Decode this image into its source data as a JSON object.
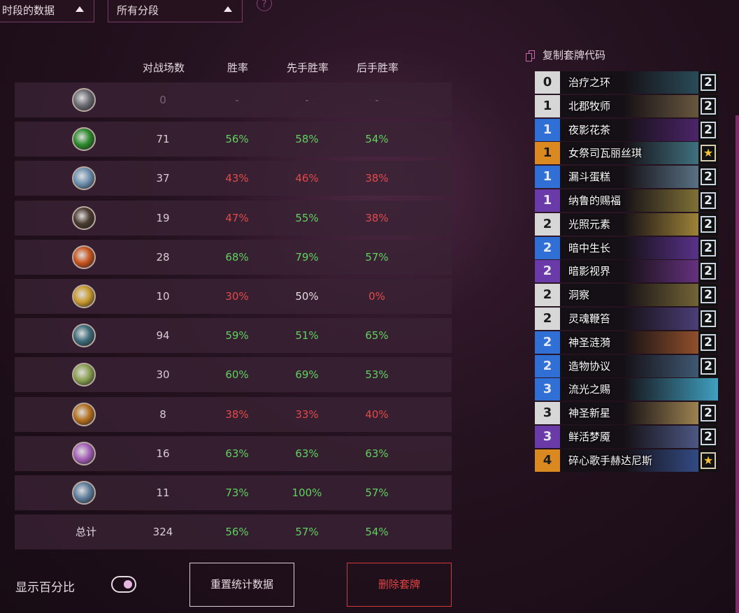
{
  "filters": {
    "rank_data": "时段的数据",
    "rank_segment": "所有分段",
    "help": "?"
  },
  "table": {
    "headers": {
      "games": "对战场数",
      "winrate": "胜率",
      "first": "先手胜率",
      "second": "后手胜率"
    },
    "rows": [
      {
        "hero_icon": "neutral-class-icon",
        "games": "0",
        "winrate": "-",
        "first": "-",
        "second": "-",
        "wr_color": "dim",
        "first_color": "dim",
        "second_color": "dim"
      },
      {
        "hero_icon": "druid-class-icon",
        "games": "71",
        "winrate": "56%",
        "first": "58%",
        "second": "54%",
        "wr_color": "green",
        "first_color": "green",
        "second_color": "green"
      },
      {
        "hero_icon": "mage-class-icon",
        "games": "37",
        "winrate": "43%",
        "first": "46%",
        "second": "38%",
        "wr_color": "red",
        "first_color": "red",
        "second_color": "red"
      },
      {
        "hero_icon": "rogue-class-icon",
        "games": "19",
        "winrate": "47%",
        "first": "55%",
        "second": "38%",
        "wr_color": "red",
        "first_color": "green",
        "second_color": "red"
      },
      {
        "hero_icon": "warlock-class-icon",
        "games": "28",
        "winrate": "68%",
        "first": "79%",
        "second": "57%",
        "wr_color": "green",
        "first_color": "green",
        "second_color": "green"
      },
      {
        "hero_icon": "paladin-class-icon",
        "games": "10",
        "winrate": "30%",
        "first": "50%",
        "second": "0%",
        "wr_color": "red",
        "first_color": "white",
        "second_color": "red"
      },
      {
        "hero_icon": "hunter-class-icon",
        "games": "94",
        "winrate": "59%",
        "first": "51%",
        "second": "65%",
        "wr_color": "green",
        "first_color": "green",
        "second_color": "green"
      },
      {
        "hero_icon": "shaman-class-icon",
        "games": "30",
        "winrate": "60%",
        "first": "69%",
        "second": "53%",
        "wr_color": "green",
        "first_color": "green",
        "second_color": "green"
      },
      {
        "hero_icon": "warrior-class-icon",
        "games": "8",
        "winrate": "38%",
        "first": "33%",
        "second": "40%",
        "wr_color": "red",
        "first_color": "red",
        "second_color": "red"
      },
      {
        "hero_icon": "priest-class-icon",
        "games": "16",
        "winrate": "63%",
        "first": "63%",
        "second": "63%",
        "wr_color": "green",
        "first_color": "green",
        "second_color": "green"
      },
      {
        "hero_icon": "demonhunter-class-icon",
        "games": "11",
        "winrate": "73%",
        "first": "100%",
        "second": "57%",
        "wr_color": "green",
        "first_color": "green",
        "second_color": "green"
      }
    ],
    "total": {
      "label": "总计",
      "games": "324",
      "winrate": "56%",
      "first": "57%",
      "second": "54%"
    }
  },
  "controls": {
    "show_percent": "显示百分比",
    "reset": "重置统计数据",
    "delete": "删除套牌"
  },
  "deck": {
    "copy_code": "复制套牌代码",
    "cards": [
      {
        "cost": "0",
        "name": "治疗之环",
        "count": "2",
        "rarity": "common"
      },
      {
        "cost": "1",
        "name": "北郡牧师",
        "count": "2",
        "rarity": "common"
      },
      {
        "cost": "1",
        "name": "夜影花茶",
        "count": "2",
        "rarity": "rare"
      },
      {
        "cost": "1",
        "name": "女祭司瓦丽丝琪",
        "count": "★",
        "rarity": "legendary"
      },
      {
        "cost": "1",
        "name": "漏斗蛋糕",
        "count": "2",
        "rarity": "rare"
      },
      {
        "cost": "1",
        "name": "纳鲁的赐福",
        "count": "2",
        "rarity": "epic"
      },
      {
        "cost": "2",
        "name": "光照元素",
        "count": "2",
        "rarity": "common"
      },
      {
        "cost": "2",
        "name": "暗中生长",
        "count": "2",
        "rarity": "rare"
      },
      {
        "cost": "2",
        "name": "暗影视界",
        "count": "2",
        "rarity": "epic"
      },
      {
        "cost": "2",
        "name": "洞察",
        "count": "2",
        "rarity": "common"
      },
      {
        "cost": "2",
        "name": "灵魂鞭笞",
        "count": "2",
        "rarity": "common"
      },
      {
        "cost": "2",
        "name": "神圣涟漪",
        "count": "2",
        "rarity": "rare"
      },
      {
        "cost": "2",
        "name": "造物协议",
        "count": "2",
        "rarity": "rare"
      },
      {
        "cost": "3",
        "name": "流光之赐",
        "count": "",
        "rarity": "rare"
      },
      {
        "cost": "3",
        "name": "神圣新星",
        "count": "2",
        "rarity": "common"
      },
      {
        "cost": "3",
        "name": "鲜活梦魇",
        "count": "2",
        "rarity": "epic"
      },
      {
        "cost": "4",
        "name": "碎心歌手赫达尼斯",
        "count": "★",
        "rarity": "legendary"
      }
    ]
  },
  "colors": {
    "common": "#d7d7d7",
    "rare": "#2f6fd6",
    "epic": "#6a3aa8",
    "legendary": "#d9891f",
    "accent": "#7a3b66",
    "green": "#5fd15f",
    "red": "#e24a4a"
  }
}
